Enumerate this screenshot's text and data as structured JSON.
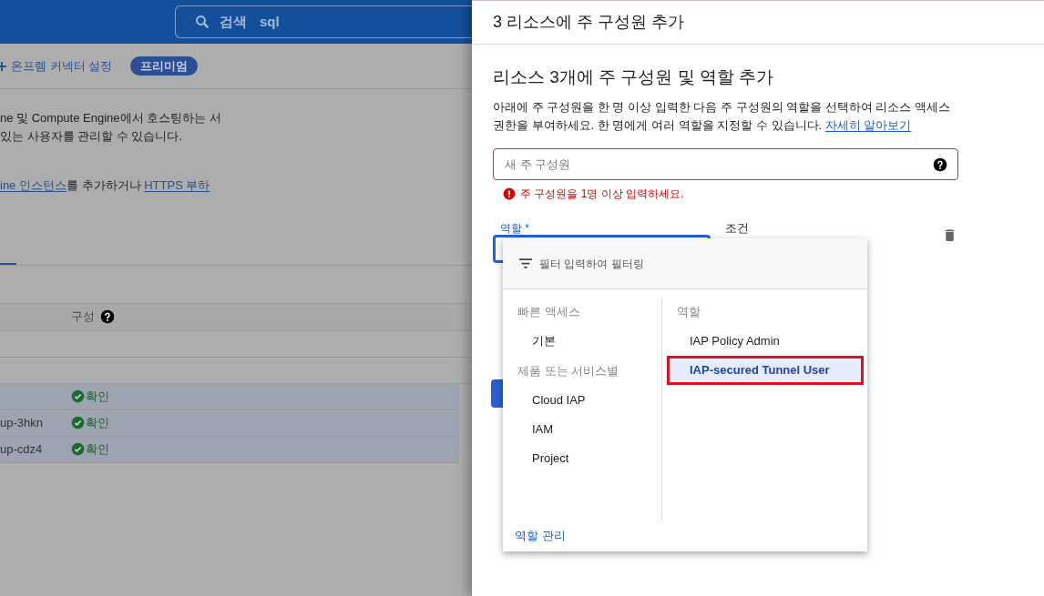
{
  "header": {
    "search": {
      "label": "검색",
      "query": "sql"
    }
  },
  "background": {
    "action": "온프렘 커넥터 설정",
    "badge": "프리미엄",
    "description": [
      "ne 및 Compute Engine에서 호스팅하는 서",
      "있는 사용자를 관리할 수 있습니다."
    ],
    "links_line": [
      {
        "kind": "link",
        "text": "ine 인스턴스"
      },
      {
        "kind": "text",
        "text": "를 추가하거나 "
      },
      {
        "kind": "link",
        "text": "HTTPS 부하"
      }
    ],
    "table": {
      "columns": [
        {
          "label": "구성",
          "help": true
        }
      ],
      "rows": [
        {
          "selected": true,
          "status": "확인"
        },
        {
          "selected": true,
          "name": "up-3hkn",
          "status": "확인"
        },
        {
          "selected": true,
          "name": "up-cdz4",
          "status": "확인"
        }
      ]
    }
  },
  "panel": {
    "title": "3 리소스에 주 구성원 추가",
    "heading": "리소스 3개에 주 구성원 및 역할 추가",
    "description": "아래에 주 구성원을 한 명 이상 입력한 다음 주 구성원의 역할을 선택하여 리소스 액세스 권한을 부여하세요. 한 명에게 여러 역할을 지정할 수 있습니다.",
    "learn_more": "자세히 알아보기",
    "principal_field": {
      "placeholder": "새 주 구성원",
      "error": true,
      "error_message": "주 구성원을 1명 이상 입력하세요."
    },
    "role_field": {
      "label": "역할 *",
      "focused": true
    },
    "condition_label": "조건"
  },
  "role_menu": {
    "filter_placeholder": "필터 입력하여 필터링",
    "groups": [
      {
        "heading": "빠른 액세스",
        "items": [
          {
            "label": "기본"
          }
        ]
      },
      {
        "heading": "제품 또는 서비스별",
        "items": [
          {
            "label": "Cloud IAP"
          },
          {
            "label": "IAM"
          },
          {
            "label": "Project"
          }
        ]
      }
    ],
    "roles_heading": "역할",
    "roles": [
      {
        "label": "IAP Policy Admin",
        "selected": false,
        "highlighted": false
      },
      {
        "label": "IAP-secured Tunnel User",
        "selected": true,
        "highlighted": true
      }
    ],
    "footer_link": "역할 관리"
  }
}
